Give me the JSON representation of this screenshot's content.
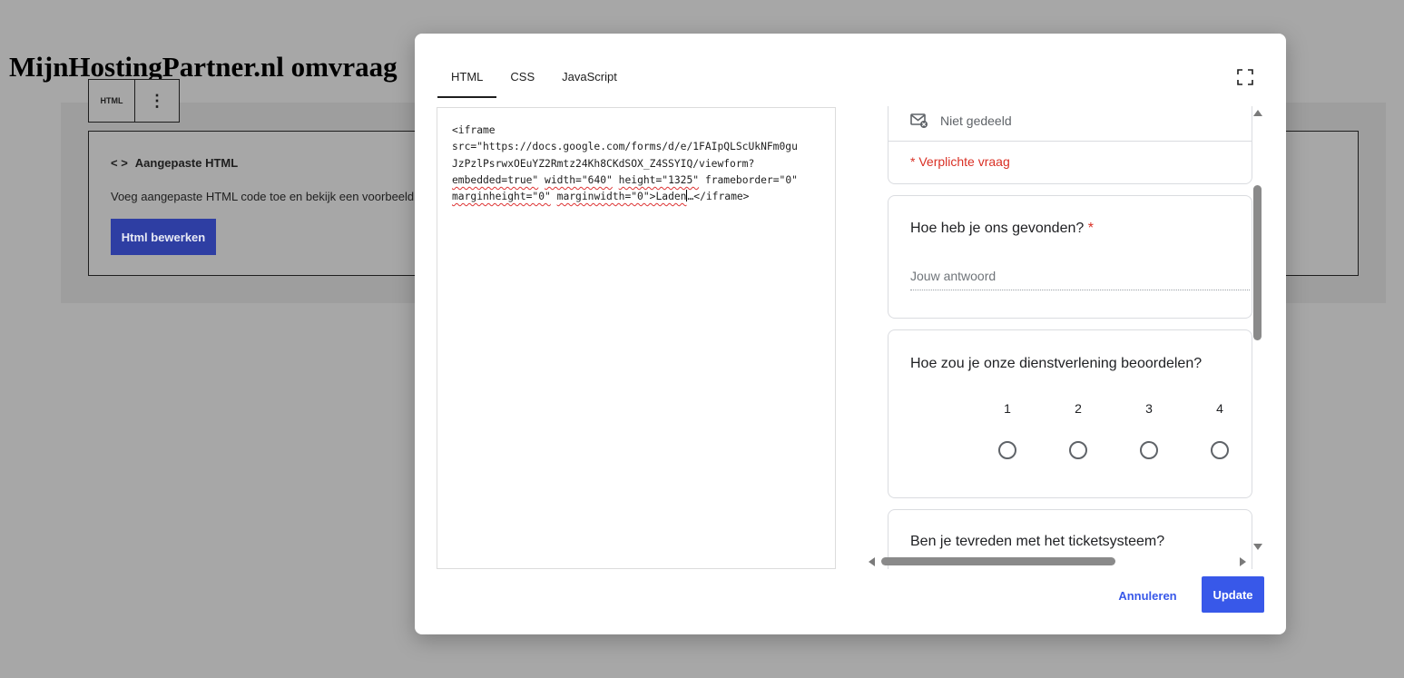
{
  "page": {
    "title": "MijnHostingPartner.nl omvraag"
  },
  "block_toolbar": {
    "html_label": "HTML",
    "more_glyph": "⋮"
  },
  "block": {
    "icon_glyph": "< >",
    "title": "Aangepaste HTML",
    "description": "Voeg aangepaste HTML code toe en bekijk een voorbeeld v",
    "edit_button": "Html bewerken"
  },
  "modal": {
    "tabs": [
      {
        "label": "HTML",
        "active": true
      },
      {
        "label": "CSS",
        "active": false
      },
      {
        "label": "JavaScript",
        "active": false
      }
    ],
    "code": {
      "l1": "<iframe",
      "l2a": "src=\"https://docs.google.com/forms/d/e/1FAIpQLScUkNFm0gu",
      "l3a": "JzPzlPsrwxOEuYZ2Rmtz24Kh8CKdSOX_Z4SSYIQ/viewform?",
      "l4_embedded": "embedded=true\"",
      "l4_width": "width=\"640\"",
      "l4_height": "height=\"1325\"",
      "l4_frameborder": "frameborder=\"0\"",
      "l5_marginheight": "marginheight=\"0\"",
      "l5_marginwidth": "marginwidth=\"0\">Laden",
      "l5_tail": "…</iframe>"
    },
    "preview": {
      "not_shared": "Niet gedeeld",
      "required_note": "* Verplichte vraag",
      "q1": "Hoe heb je ons gevonden?",
      "q1_star": "*",
      "q1_placeholder": "Jouw antwoord",
      "q2": "Hoe zou je onze dienstverlening beoordelen?",
      "scale": [
        "1",
        "2",
        "3",
        "4"
      ],
      "q3": "Ben je tevreden met het ticketsysteem?"
    },
    "cancel_label": "Annuleren",
    "update_label": "Update"
  }
}
